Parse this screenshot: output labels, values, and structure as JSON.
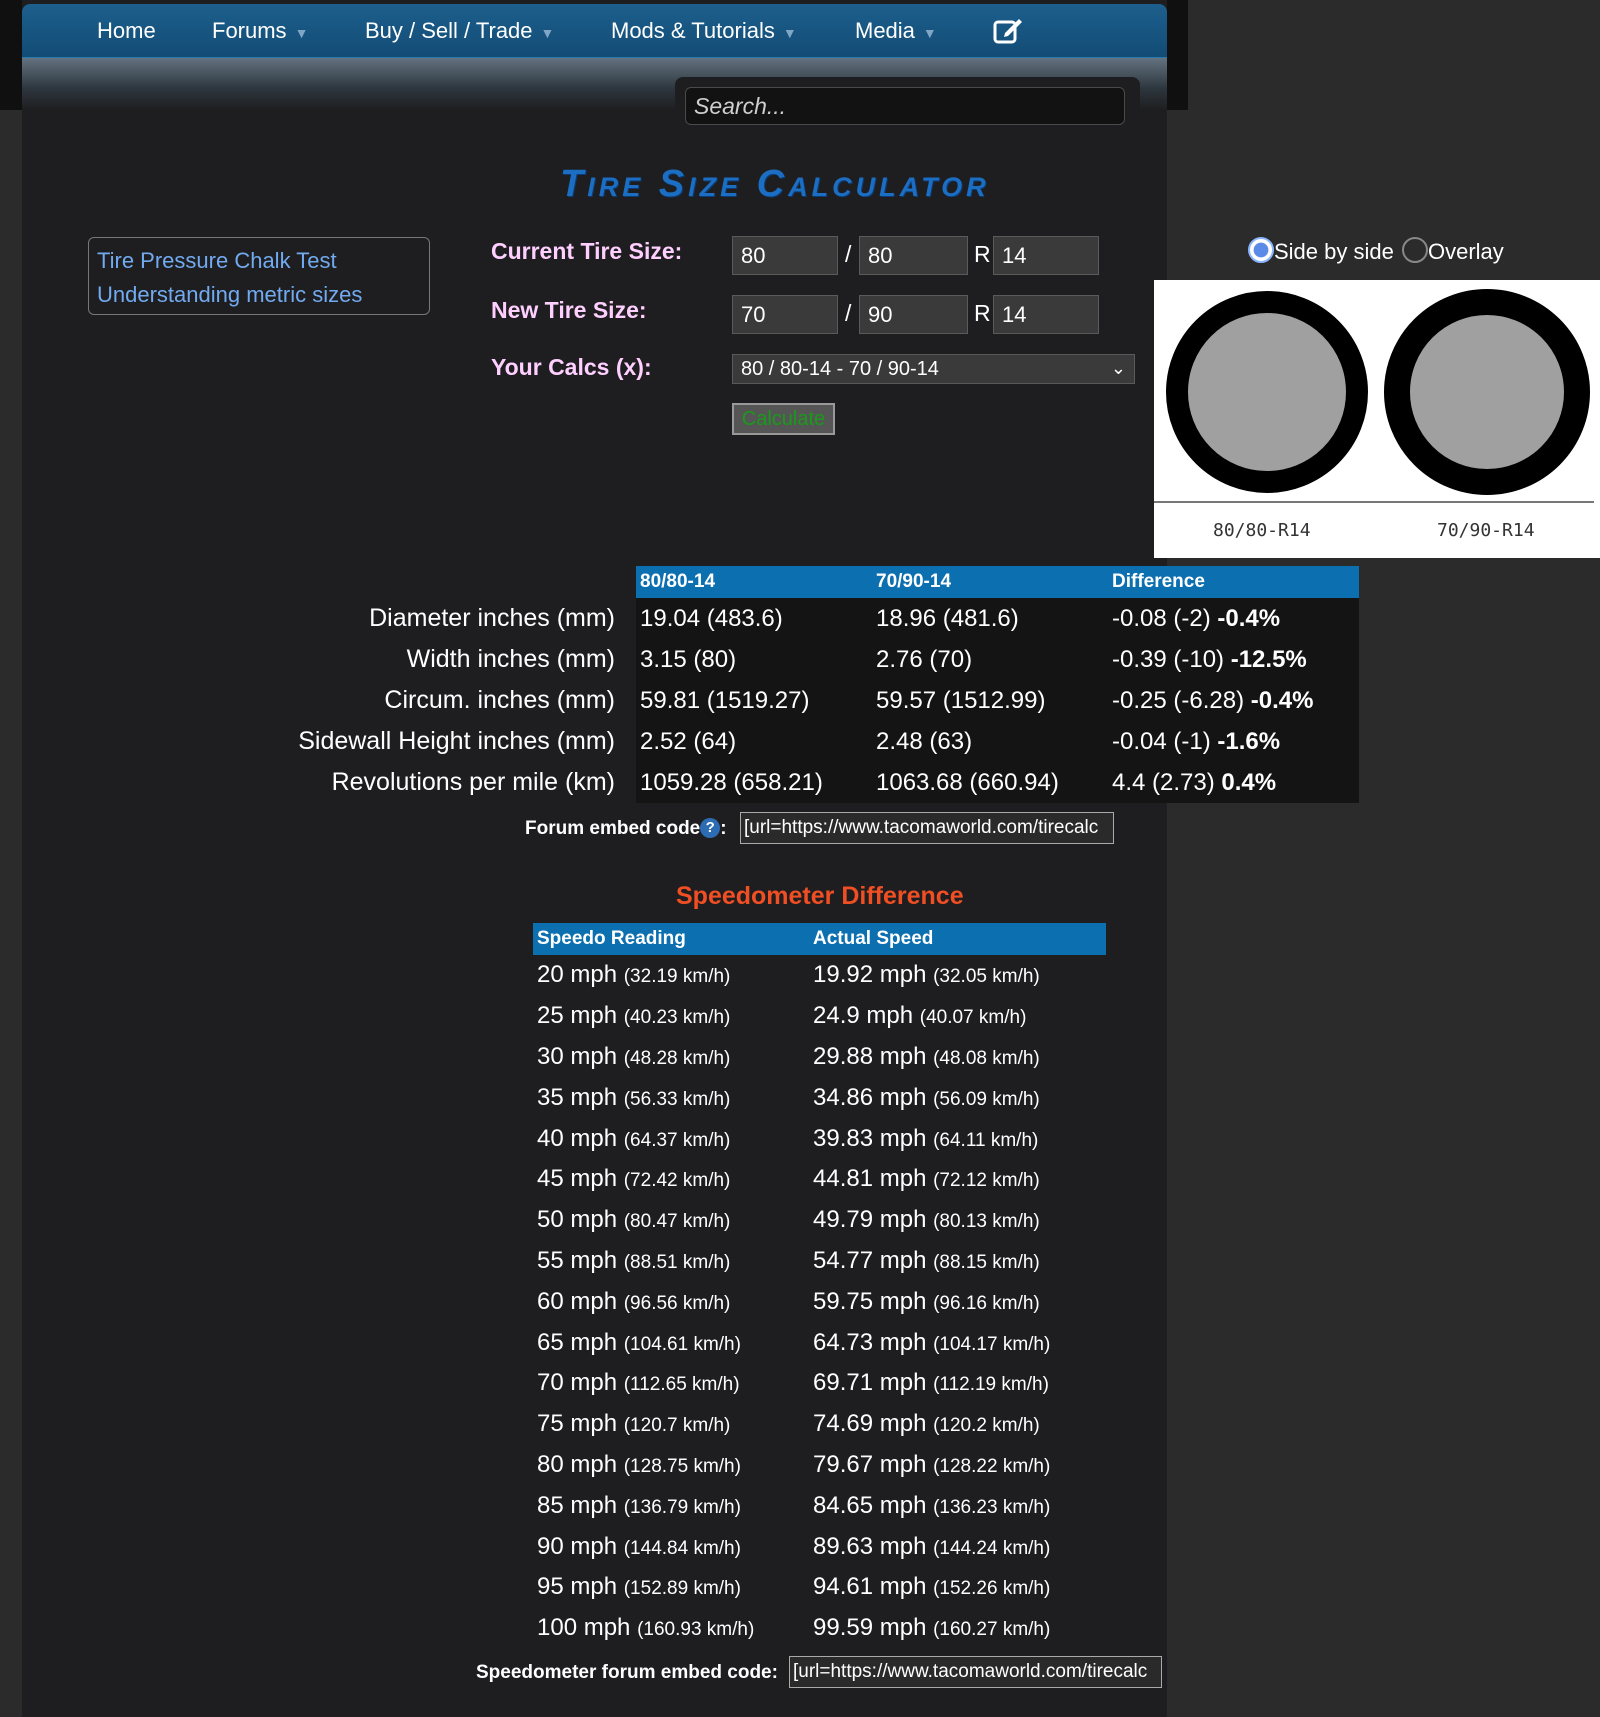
{
  "nav": {
    "items": [
      {
        "label": "Home",
        "dropdown": false
      },
      {
        "label": "Forums",
        "dropdown": true
      },
      {
        "label": "Buy / Sell / Trade",
        "dropdown": true
      },
      {
        "label": "Mods & Tutorials",
        "dropdown": true
      },
      {
        "label": "Media",
        "dropdown": true
      }
    ],
    "dropdown_arrow": "▼",
    "edit_icon": "edit-icon"
  },
  "search": {
    "placeholder": "Search..."
  },
  "page_title": "Tire Size Calculator",
  "links": [
    "Tire Pressure Chalk Test",
    "Understanding metric sizes"
  ],
  "form": {
    "current_label": "Current Tire Size:",
    "new_label": "New Tire Size:",
    "calcs_label": "Your Calcs (x):",
    "current": {
      "width": "80",
      "ratio": "80",
      "rim": "14"
    },
    "new": {
      "width": "70",
      "ratio": "90",
      "rim": "14"
    },
    "slash": "/",
    "r": "R",
    "calcs_selected": "80 / 80-14 - 70 / 90-14",
    "calculate_label": "Calculate"
  },
  "view": {
    "options": [
      "Side by side",
      "Overlay"
    ],
    "selected": "Side by side"
  },
  "tire_captions": [
    "80/80-R14",
    "70/90-R14"
  ],
  "comparison": {
    "headers": [
      "80/80-14",
      "70/90-14",
      "Difference"
    ],
    "rows": [
      {
        "label": "Diameter inches (mm)",
        "current": "19.04 (483.6)",
        "new": "18.96 (481.6)",
        "diff": "-0.08 (-2)",
        "pct": "-0.4%"
      },
      {
        "label": "Width inches (mm)",
        "current": "3.15 (80)",
        "new": "2.76 (70)",
        "diff": "-0.39 (-10)",
        "pct": "-12.5%"
      },
      {
        "label": "Circum. inches (mm)",
        "current": "59.81 (1519.27)",
        "new": "59.57 (1512.99)",
        "diff": "-0.25 (-6.28)",
        "pct": "-0.4%"
      },
      {
        "label": "Sidewall Height inches (mm)",
        "current": "2.52 (64)",
        "new": "2.48 (63)",
        "diff": "-0.04 (-1)",
        "pct": "-1.6%"
      },
      {
        "label": "Revolutions per mile (km)",
        "current": "1059.28 (658.21)",
        "new": "1063.68 (660.94)",
        "diff": "4.4 (2.73)",
        "pct": "0.4%"
      }
    ]
  },
  "forum_embed": {
    "label": "Forum embed code",
    "colon": ":",
    "value": "[url=https://www.tacomaworld.com/tirecalc"
  },
  "speedo": {
    "title": "Speedometer Difference",
    "headers": [
      "Speedo Reading",
      "Actual Speed"
    ],
    "rows": [
      {
        "reading": "20 mph",
        "reading_kmh": "(32.19 km/h)",
        "actual": "19.92 mph",
        "actual_kmh": "(32.05 km/h)"
      },
      {
        "reading": "25 mph",
        "reading_kmh": "(40.23 km/h)",
        "actual": "24.9 mph",
        "actual_kmh": "(40.07 km/h)"
      },
      {
        "reading": "30 mph",
        "reading_kmh": "(48.28 km/h)",
        "actual": "29.88 mph",
        "actual_kmh": "(48.08 km/h)"
      },
      {
        "reading": "35 mph",
        "reading_kmh": "(56.33 km/h)",
        "actual": "34.86 mph",
        "actual_kmh": "(56.09 km/h)"
      },
      {
        "reading": "40 mph",
        "reading_kmh": "(64.37 km/h)",
        "actual": "39.83 mph",
        "actual_kmh": "(64.11 km/h)"
      },
      {
        "reading": "45 mph",
        "reading_kmh": "(72.42 km/h)",
        "actual": "44.81 mph",
        "actual_kmh": "(72.12 km/h)"
      },
      {
        "reading": "50 mph",
        "reading_kmh": "(80.47 km/h)",
        "actual": "49.79 mph",
        "actual_kmh": "(80.13 km/h)"
      },
      {
        "reading": "55 mph",
        "reading_kmh": "(88.51 km/h)",
        "actual": "54.77 mph",
        "actual_kmh": "(88.15 km/h)"
      },
      {
        "reading": "60 mph",
        "reading_kmh": "(96.56 km/h)",
        "actual": "59.75 mph",
        "actual_kmh": "(96.16 km/h)"
      },
      {
        "reading": "65 mph",
        "reading_kmh": "(104.61 km/h)",
        "actual": "64.73 mph",
        "actual_kmh": "(104.17 km/h)"
      },
      {
        "reading": "70 mph",
        "reading_kmh": "(112.65 km/h)",
        "actual": "69.71 mph",
        "actual_kmh": "(112.19 km/h)"
      },
      {
        "reading": "75 mph",
        "reading_kmh": "(120.7 km/h)",
        "actual": "74.69 mph",
        "actual_kmh": "(120.2 km/h)"
      },
      {
        "reading": "80 mph",
        "reading_kmh": "(128.75 km/h)",
        "actual": "79.67 mph",
        "actual_kmh": "(128.22 km/h)"
      },
      {
        "reading": "85 mph",
        "reading_kmh": "(136.79 km/h)",
        "actual": "84.65 mph",
        "actual_kmh": "(136.23 km/h)"
      },
      {
        "reading": "90 mph",
        "reading_kmh": "(144.84 km/h)",
        "actual": "89.63 mph",
        "actual_kmh": "(144.24 km/h)"
      },
      {
        "reading": "95 mph",
        "reading_kmh": "(152.89 km/h)",
        "actual": "94.61 mph",
        "actual_kmh": "(152.26 km/h)"
      },
      {
        "reading": "100 mph",
        "reading_kmh": "(160.93 km/h)",
        "actual": "99.59 mph",
        "actual_kmh": "(160.27 km/h)"
      }
    ]
  },
  "speedo_embed": {
    "label": "Speedometer forum embed code:",
    "value": "[url=https://www.tacomaworld.com/tirecalc"
  }
}
